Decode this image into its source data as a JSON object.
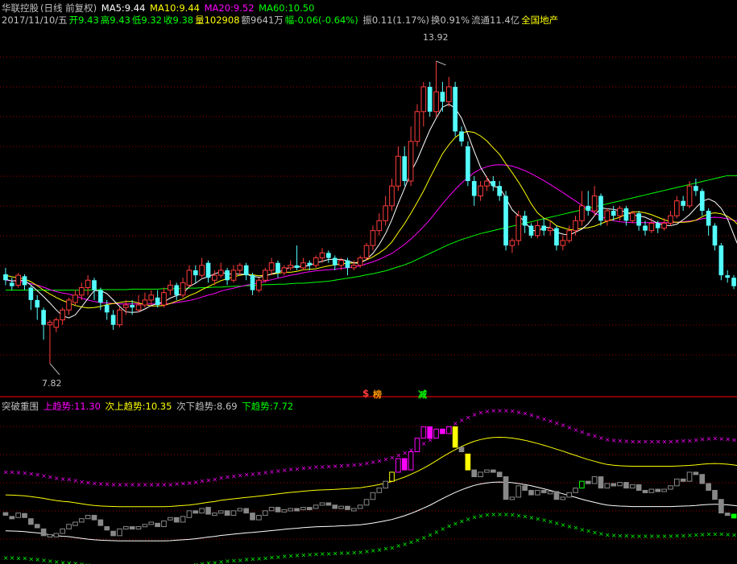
{
  "colors": {
    "up": "#ff3c3c",
    "down": "#54ffff",
    "ma5": "#ffffff",
    "ma10": "#ffff00",
    "ma20": "#ff00ff",
    "ma60": "#00ff00",
    "grid": "#a00000",
    "axis": "#ff0000",
    "inner": "#888888",
    "text": "#c0c0c0",
    "gold": "#ffff00",
    "green": "#00ff00",
    "magenta": "#ff00ff",
    "neutral": "#c0c0c0"
  },
  "header": {
    "stock": "华联控股",
    "period": "(日线 前复权)",
    "ma5_label": "MA5:",
    "ma5_value": "9.44",
    "ma10_label": "MA10:",
    "ma10_value": "9.44",
    "ma20_label": "MA20:",
    "ma20_value": "9.52",
    "ma60_label": "MA60:",
    "ma60_value": "10.50"
  },
  "quote": {
    "date": "2017/11/10/五",
    "open": "开9.43",
    "high": "高9.43",
    "low": "低9.32",
    "close": "收9.38",
    "volume": "量102908",
    "amount": "额9641万",
    "change": "幅-0.06(-0.64%)",
    "amplitude": "振0.11(1.17%)",
    "turnover": "换0.91%",
    "float": "流通11.4亿",
    "sector": "全国地产"
  },
  "annotations": {
    "high": "13.92",
    "low": "7.82",
    "mark1": "$",
    "mark2": "榜",
    "mark3": "减"
  },
  "indicator": {
    "name": "突破重围",
    "up_label": "上趋势:",
    "up_value": "11.30",
    "up2_label": "次上趋势:",
    "up2_value": "10.35",
    "down2_label": "次下趋势:",
    "down2_value": "8.69",
    "down_label": "下趋势:",
    "down_value": "7.72"
  },
  "chart_data": {
    "type": "candlestick",
    "y_range": [
      7.2,
      14.6
    ],
    "candles": [
      [
        9.62,
        9.5,
        9.75,
        9.4
      ],
      [
        9.45,
        9.38,
        9.55,
        9.3
      ],
      [
        9.4,
        9.6,
        9.65,
        9.35
      ],
      [
        9.58,
        9.4,
        9.62,
        9.3
      ],
      [
        9.35,
        9.1,
        9.4,
        8.9
      ],
      [
        9.1,
        8.95,
        9.2,
        8.7
      ],
      [
        8.9,
        8.6,
        8.95,
        8.3
      ],
      [
        8.6,
        8.65,
        8.7,
        7.82
      ],
      [
        8.55,
        8.7,
        8.75,
        8.45
      ],
      [
        8.7,
        8.9,
        8.95,
        8.6
      ],
      [
        8.9,
        9.1,
        9.15,
        8.8
      ],
      [
        9.05,
        9.2,
        9.3,
        9.0
      ],
      [
        9.2,
        9.35,
        9.45,
        9.1
      ],
      [
        9.35,
        9.5,
        9.6,
        9.2
      ],
      [
        9.5,
        9.3,
        9.55,
        9.1
      ],
      [
        9.3,
        9.05,
        9.35,
        8.9
      ],
      [
        9.0,
        8.85,
        9.1,
        8.7
      ],
      [
        8.8,
        8.6,
        8.9,
        8.5
      ],
      [
        8.6,
        8.9,
        8.95,
        8.55
      ],
      [
        8.95,
        9.0,
        9.1,
        8.8
      ],
      [
        9.0,
        8.95,
        9.1,
        8.8
      ],
      [
        8.9,
        9.0,
        9.2,
        8.85
      ],
      [
        9.0,
        9.1,
        9.25,
        8.95
      ],
      [
        9.1,
        9.2,
        9.3,
        9.0
      ],
      [
        9.15,
        9.0,
        9.3,
        8.95
      ],
      [
        9.0,
        9.25,
        9.35,
        8.95
      ],
      [
        9.3,
        9.4,
        9.5,
        9.2
      ],
      [
        9.4,
        9.2,
        9.45,
        9.1
      ],
      [
        9.2,
        9.45,
        9.55,
        9.15
      ],
      [
        9.4,
        9.7,
        9.8,
        9.35
      ],
      [
        9.7,
        9.6,
        9.8,
        9.45
      ],
      [
        9.6,
        9.8,
        9.95,
        9.55
      ],
      [
        9.85,
        9.55,
        9.9,
        9.45
      ],
      [
        9.5,
        9.6,
        9.7,
        9.4
      ],
      [
        9.6,
        9.7,
        9.85,
        9.55
      ],
      [
        9.7,
        9.5,
        9.75,
        9.4
      ],
      [
        9.5,
        9.7,
        9.8,
        9.45
      ],
      [
        9.7,
        9.8,
        9.85,
        9.6
      ],
      [
        9.8,
        9.6,
        9.85,
        9.5
      ],
      [
        9.6,
        9.3,
        9.65,
        9.2
      ],
      [
        9.3,
        9.5,
        9.55,
        9.25
      ],
      [
        9.5,
        9.7,
        9.75,
        9.45
      ],
      [
        9.7,
        9.85,
        9.95,
        9.6
      ],
      [
        9.85,
        9.65,
        9.9,
        9.55
      ],
      [
        9.65,
        9.75,
        9.8,
        9.6
      ],
      [
        9.75,
        9.8,
        9.9,
        9.7
      ],
      [
        9.8,
        9.75,
        10.2,
        9.7
      ],
      [
        9.75,
        9.85,
        9.95,
        9.7
      ],
      [
        9.85,
        9.8,
        9.9,
        9.7
      ],
      [
        9.8,
        9.95,
        10.0,
        9.75
      ],
      [
        9.95,
        10.05,
        10.15,
        9.85
      ],
      [
        10.05,
        9.95,
        10.1,
        9.85
      ],
      [
        9.95,
        9.8,
        10.0,
        9.7
      ],
      [
        9.8,
        9.9,
        9.95,
        9.7
      ],
      [
        9.9,
        9.75,
        9.95,
        9.6
      ],
      [
        9.75,
        9.8,
        9.9,
        9.7
      ],
      [
        9.8,
        9.95,
        10.0,
        9.75
      ],
      [
        9.95,
        10.2,
        10.25,
        9.9
      ],
      [
        10.2,
        10.5,
        10.6,
        10.1
      ],
      [
        10.5,
        10.7,
        10.85,
        10.4
      ],
      [
        10.7,
        11.0,
        11.2,
        10.6
      ],
      [
        11.0,
        11.4,
        11.55,
        10.9
      ],
      [
        11.4,
        12.0,
        12.2,
        11.3
      ],
      [
        12.0,
        11.5,
        12.2,
        11.4
      ],
      [
        11.5,
        12.3,
        12.6,
        11.4
      ],
      [
        12.3,
        12.9,
        13.05,
        12.2
      ],
      [
        12.9,
        13.4,
        13.5,
        12.6
      ],
      [
        13.4,
        12.9,
        13.5,
        12.8
      ],
      [
        12.9,
        13.3,
        13.92,
        12.8
      ],
      [
        13.3,
        13.1,
        13.5,
        12.9
      ],
      [
        13.1,
        13.4,
        13.6,
        13.0
      ],
      [
        13.4,
        12.5,
        13.5,
        12.4
      ],
      [
        12.5,
        12.3,
        12.6,
        12.2
      ],
      [
        12.2,
        11.5,
        12.3,
        11.4
      ],
      [
        11.5,
        11.2,
        11.6,
        11.0
      ],
      [
        11.2,
        11.4,
        11.5,
        11.1
      ],
      [
        11.4,
        11.5,
        11.6,
        11.3
      ],
      [
        11.5,
        11.4,
        11.6,
        11.3
      ],
      [
        11.4,
        11.2,
        11.5,
        11.1
      ],
      [
        11.2,
        10.2,
        11.3,
        10.1
      ],
      [
        10.2,
        10.3,
        10.35,
        10.05
      ],
      [
        10.3,
        10.8,
        10.9,
        10.2
      ],
      [
        10.8,
        10.6,
        10.9,
        10.45
      ],
      [
        10.6,
        10.4,
        10.65,
        10.35
      ],
      [
        10.4,
        10.6,
        10.7,
        10.35
      ],
      [
        10.6,
        10.5,
        10.75,
        10.4
      ],
      [
        10.5,
        10.55,
        10.7,
        10.4
      ],
      [
        10.55,
        10.2,
        10.6,
        10.1
      ],
      [
        10.2,
        10.3,
        10.4,
        10.1
      ],
      [
        10.3,
        10.5,
        10.6,
        10.25
      ],
      [
        10.5,
        10.7,
        10.8,
        10.4
      ],
      [
        10.7,
        11.0,
        11.3,
        10.6
      ],
      [
        11.0,
        10.9,
        11.3,
        10.8
      ],
      [
        10.9,
        11.2,
        11.4,
        10.8
      ],
      [
        11.2,
        10.7,
        11.25,
        10.6
      ],
      [
        10.7,
        10.9,
        10.95,
        10.6
      ],
      [
        10.9,
        10.8,
        11.0,
        10.7
      ],
      [
        10.8,
        10.95,
        11.0,
        10.7
      ],
      [
        10.95,
        10.7,
        11.0,
        10.6
      ],
      [
        10.7,
        10.85,
        10.9,
        10.65
      ],
      [
        10.85,
        10.6,
        10.9,
        10.5
      ],
      [
        10.6,
        10.5,
        10.7,
        10.4
      ],
      [
        10.5,
        10.65,
        10.75,
        10.45
      ],
      [
        10.65,
        10.55,
        10.7,
        10.45
      ],
      [
        10.55,
        10.65,
        10.75,
        10.5
      ],
      [
        10.65,
        10.8,
        10.9,
        10.6
      ],
      [
        10.8,
        11.1,
        11.2,
        10.75
      ],
      [
        11.1,
        11.0,
        11.2,
        10.9
      ],
      [
        11.0,
        11.4,
        11.5,
        10.95
      ],
      [
        11.4,
        11.3,
        11.55,
        11.2
      ],
      [
        11.3,
        10.9,
        11.35,
        10.8
      ],
      [
        10.9,
        10.6,
        10.95,
        10.4
      ],
      [
        10.6,
        10.2,
        10.65,
        10.1
      ],
      [
        10.2,
        9.6,
        10.25,
        9.5
      ],
      [
        9.6,
        9.55,
        9.7,
        9.45
      ],
      [
        9.55,
        9.38,
        9.6,
        9.32
      ]
    ],
    "ma5": [
      9.52,
      9.48,
      9.5,
      9.49,
      9.4,
      9.29,
      9.17,
      9.04,
      8.9,
      8.78,
      8.74,
      8.8,
      8.96,
      9.13,
      9.29,
      9.29,
      9.23,
      9.1,
      8.97,
      8.86,
      8.85,
      8.86,
      8.92,
      8.99,
      9.03,
      9.06,
      9.14,
      9.19,
      9.23,
      9.37,
      9.44,
      9.53,
      9.57,
      9.63,
      9.67,
      9.62,
      9.63,
      9.62,
      9.62,
      9.58,
      9.56,
      9.58,
      9.63,
      9.66,
      9.71,
      9.76,
      9.77,
      9.77,
      9.8,
      9.85,
      9.88,
      9.92,
      9.92,
      9.92,
      9.89,
      9.85,
      9.84,
      9.92,
      10.04,
      10.22,
      10.44,
      10.72,
      11.05,
      11.35,
      11.68,
      11.93,
      12.23,
      12.53,
      12.77,
      12.99,
      13.05,
      12.97,
      12.77,
      12.44,
      12.1,
      11.78,
      11.57,
      11.39,
      11.37,
      11.16,
      10.92,
      10.8,
      10.68,
      10.52,
      10.48,
      10.57,
      10.56,
      10.47,
      10.43,
      10.41,
      10.47,
      10.53,
      10.64,
      10.8,
      10.96,
      10.94,
      10.93,
      10.9,
      10.88,
      10.81,
      10.8,
      10.77,
      10.71,
      10.65,
      10.61,
      10.6,
      10.63,
      10.72,
      10.82,
      10.96,
      11.09,
      11.14,
      11.08,
      10.95,
      10.74,
      10.41,
      10.1
    ],
    "ma10": [
      9.6,
      9.57,
      9.55,
      9.52,
      9.47,
      9.39,
      9.3,
      9.22,
      9.15,
      9.09,
      9.04,
      8.99,
      8.96,
      8.94,
      8.95,
      8.97,
      9.01,
      9.03,
      9.05,
      9.07,
      9.07,
      9.04,
      9.01,
      8.98,
      8.98,
      8.99,
      9.03,
      9.08,
      9.12,
      9.19,
      9.24,
      9.31,
      9.37,
      9.43,
      9.49,
      9.53,
      9.57,
      9.6,
      9.62,
      9.61,
      9.59,
      9.6,
      9.62,
      9.64,
      9.66,
      9.66,
      9.68,
      9.71,
      9.72,
      9.73,
      9.76,
      9.79,
      9.81,
      9.83,
      9.84,
      9.85,
      9.87,
      9.91,
      9.97,
      10.05,
      10.14,
      10.27,
      10.46,
      10.64,
      10.85,
      11.07,
      11.3,
      11.56,
      11.81,
      12.05,
      12.23,
      12.38,
      12.47,
      12.5,
      12.48,
      12.41,
      12.31,
      12.17,
      12.04,
      11.85,
      11.67,
      11.48,
      11.27,
      11.04,
      10.86,
      10.75,
      10.7,
      10.6,
      10.56,
      10.52,
      10.52,
      10.55,
      10.56,
      10.59,
      10.64,
      10.69,
      10.73,
      10.77,
      10.83,
      10.88,
      10.88,
      10.86,
      10.82,
      10.77,
      10.72,
      10.68,
      10.67,
      10.67,
      10.68,
      10.71,
      10.78,
      10.84,
      10.86,
      10.84,
      10.79,
      10.7,
      10.57
    ],
    "ma20": [
      9.5,
      9.49,
      9.48,
      9.46,
      9.43,
      9.4,
      9.36,
      9.31,
      9.27,
      9.24,
      9.22,
      9.18,
      9.14,
      9.1,
      9.07,
      9.05,
      9.04,
      9.03,
      9.02,
      9.02,
      9.02,
      9.02,
      9.02,
      9.02,
      9.02,
      9.02,
      9.03,
      9.05,
      9.07,
      9.09,
      9.12,
      9.16,
      9.2,
      9.23,
      9.28,
      9.31,
      9.34,
      9.37,
      9.4,
      9.42,
      9.45,
      9.48,
      9.51,
      9.54,
      9.57,
      9.6,
      9.62,
      9.65,
      9.67,
      9.69,
      9.7,
      9.71,
      9.72,
      9.74,
      9.75,
      9.77,
      9.79,
      9.83,
      9.87,
      9.92,
      9.98,
      10.04,
      10.13,
      10.22,
      10.33,
      10.45,
      10.58,
      10.72,
      10.88,
      11.04,
      11.19,
      11.33,
      11.46,
      11.57,
      11.67,
      11.74,
      11.79,
      11.82,
      11.83,
      11.82,
      11.8,
      11.76,
      11.71,
      11.65,
      11.58,
      11.51,
      11.43,
      11.35,
      11.27,
      11.18,
      11.1,
      11.01,
      10.93,
      10.86,
      10.79,
      10.73,
      10.7,
      10.68,
      10.67,
      10.66,
      10.66,
      10.66,
      10.66,
      10.66,
      10.66,
      10.66,
      10.67,
      10.68,
      10.69,
      10.71,
      10.74,
      10.76,
      10.77,
      10.76,
      10.74,
      10.71,
      10.67
    ],
    "ma60": [
      9.3,
      9.3,
      9.3,
      9.3,
      9.3,
      9.3,
      9.3,
      9.3,
      9.3,
      9.3,
      9.3,
      9.3,
      9.3,
      9.3,
      9.31,
      9.31,
      9.31,
      9.31,
      9.31,
      9.31,
      9.32,
      9.32,
      9.32,
      9.32,
      9.32,
      9.33,
      9.33,
      9.33,
      9.33,
      9.34,
      9.34,
      9.35,
      9.35,
      9.36,
      9.36,
      9.37,
      9.38,
      9.38,
      9.39,
      9.39,
      9.4,
      9.41,
      9.41,
      9.42,
      9.42,
      9.43,
      9.44,
      9.44,
      9.45,
      9.46,
      9.47,
      9.48,
      9.5,
      9.52,
      9.54,
      9.56,
      9.58,
      9.61,
      9.63,
      9.66,
      9.69,
      9.73,
      9.77,
      9.81,
      9.86,
      9.92,
      9.98,
      10.04,
      10.1,
      10.16,
      10.22,
      10.27,
      10.32,
      10.36,
      10.4,
      10.44,
      10.47,
      10.5,
      10.53,
      10.56,
      10.59,
      10.62,
      10.65,
      10.68,
      10.71,
      10.74,
      10.77,
      10.8,
      10.83,
      10.86,
      10.89,
      10.92,
      10.95,
      10.98,
      11.01,
      11.04,
      11.07,
      11.1,
      11.13,
      11.16,
      11.19,
      11.22,
      11.25,
      11.28,
      11.31,
      11.34,
      11.37,
      11.4,
      11.43,
      11.46,
      11.49,
      11.52,
      11.55,
      11.58,
      11.61,
      11.61,
      11.6,
      11.58,
      11.56,
      11.54,
      11.52
    ]
  }
}
